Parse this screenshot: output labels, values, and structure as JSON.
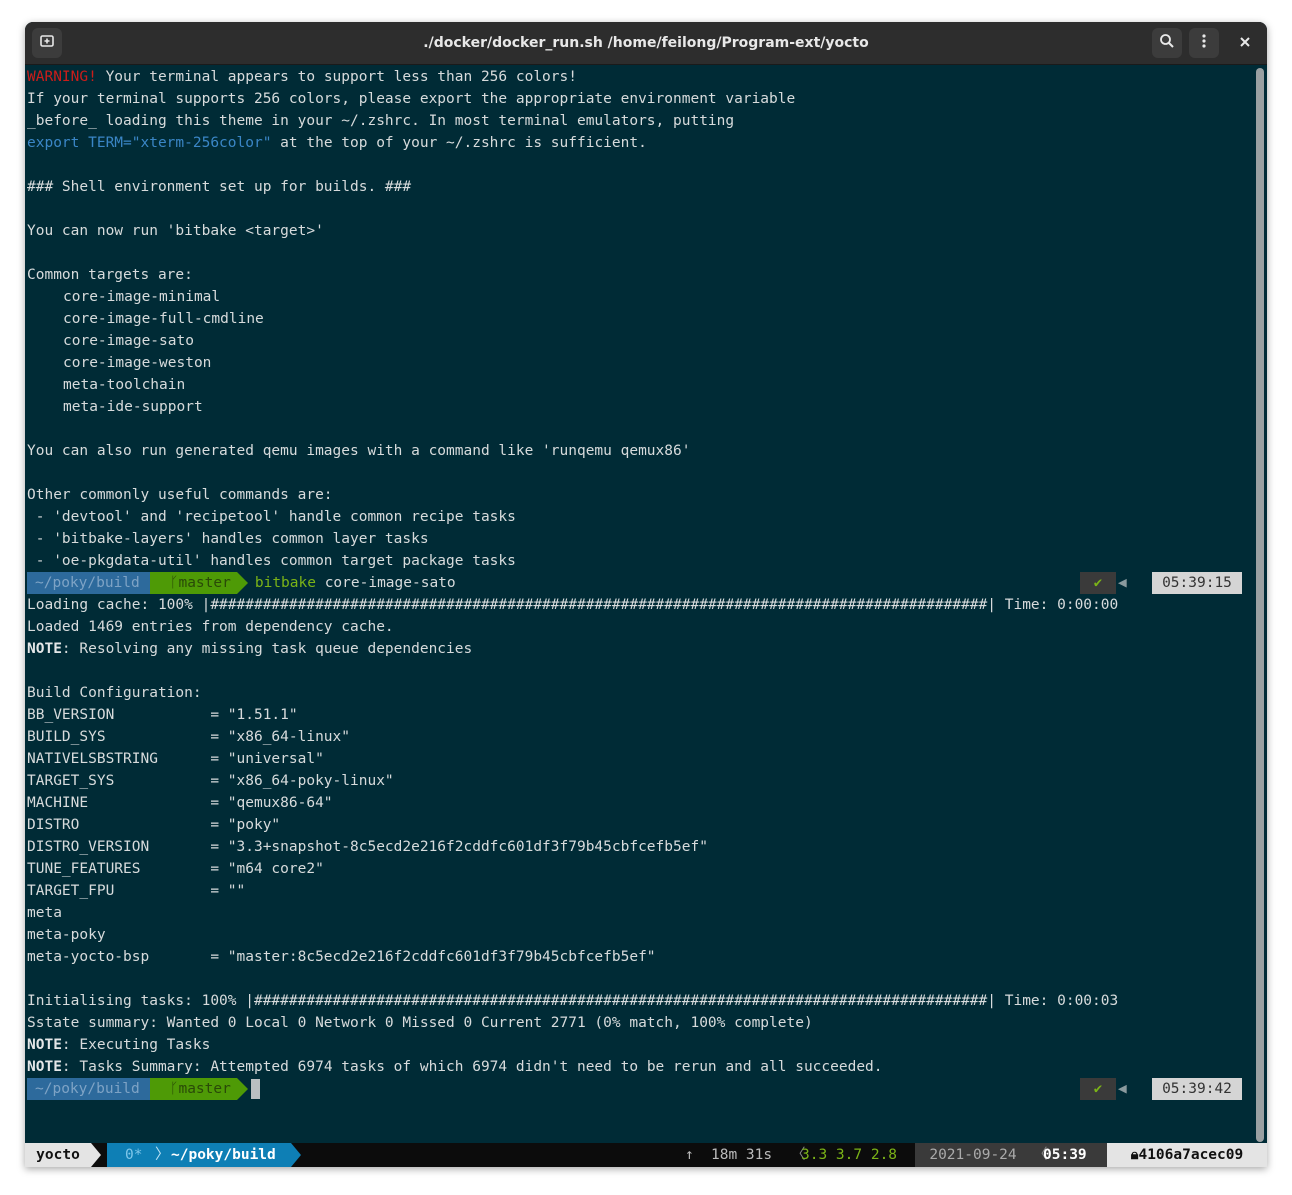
{
  "window": {
    "title": "./docker/docker_run.sh /home/feilong/Program-ext/yocto",
    "new_tab_icon": "new-tab-icon",
    "search_icon": "search-icon",
    "menu_icon": "kebab-menu-icon",
    "close_icon": "close-icon"
  },
  "output1": {
    "warning_label": "WARNING!",
    "warning_rest": " Your terminal appears to support less than 256 colors!",
    "l2": "If your terminal supports 256 colors, please export the appropriate environment variable",
    "l3": "_before_ loading this theme in your ~/.zshrc. In most terminal emulators, putting",
    "l4_export": "export TERM=\"xterm-256color\"",
    "l4_rest": " at the top of your ~/.zshrc is sufficient.",
    "l6": "### Shell environment set up for builds. ###",
    "l8": "You can now run 'bitbake <target>'",
    "l10": "Common targets are:",
    "targets": [
      "core-image-minimal",
      "core-image-full-cmdline",
      "core-image-sato",
      "core-image-weston",
      "meta-toolchain",
      "meta-ide-support"
    ],
    "l18": "You can also run generated qemu images with a command like 'runqemu qemux86'",
    "l20": "Other commonly useful commands are:",
    "cmds": [
      " - 'devtool' and 'recipetool' handle common recipe tasks",
      " - 'bitbake-layers' handles common layer tasks",
      " - 'oe-pkgdata-util' handles common target package tasks"
    ]
  },
  "prompt1": {
    "dir": "~/poky/build",
    "branch": "master",
    "cmd_name": "bitbake",
    "cmd_args": " core-image-sato",
    "status": "✔",
    "time": "05:39:15"
  },
  "output2": {
    "loading": "Loading cache: 100% |#########################################################################################| Time: 0:00:00",
    "loaded": "Loaded 1469 entries from dependency cache.",
    "note_label": "NOTE",
    "note1": ": Resolving any missing task queue dependencies",
    "build_config": "Build Configuration:",
    "config": [
      "BB_VERSION           = \"1.51.1\"",
      "BUILD_SYS            = \"x86_64-linux\"",
      "NATIVELSBSTRING      = \"universal\"",
      "TARGET_SYS           = \"x86_64-poky-linux\"",
      "MACHINE              = \"qemux86-64\"",
      "DISTRO               = \"poky\"",
      "DISTRO_VERSION       = \"3.3+snapshot-8c5ecd2e216f2cddfc601df3f79b45cbfcefb5ef\"",
      "TUNE_FEATURES        = \"m64 core2\"",
      "TARGET_FPU           = \"\"",
      "meta",
      "meta-poky",
      "meta-yocto-bsp       = \"master:8c5ecd2e216f2cddfc601df3f79b45cbfcefb5ef\""
    ],
    "init": "Initialising tasks: 100% |####################################################################################| Time: 0:00:03",
    "sstate": "Sstate summary: Wanted 0 Local 0 Network 0 Missed 0 Current 2771 (0% match, 100% complete)",
    "note2": ": Executing Tasks",
    "note3": ": Tasks Summary: Attempted 6974 tasks of which 6974 didn't need to be rerun and all succeeded."
  },
  "prompt2": {
    "dir": "~/poky/build",
    "branch": "master",
    "status": "✔",
    "time": "05:39:42"
  },
  "tmux": {
    "session": "yocto",
    "window_index": "0*",
    "window_path": "~/poky/build",
    "uptime": "18m 31s",
    "load": "3.3 3.7 2.8",
    "date": "2021-09-24",
    "clock": "05:39",
    "host": "4106a7acec09"
  },
  "colors": {
    "background": "#002b36",
    "warning": "#cb1d1a",
    "dir_segment": "#2d6a9c",
    "git_segment": "#4e9a06"
  }
}
